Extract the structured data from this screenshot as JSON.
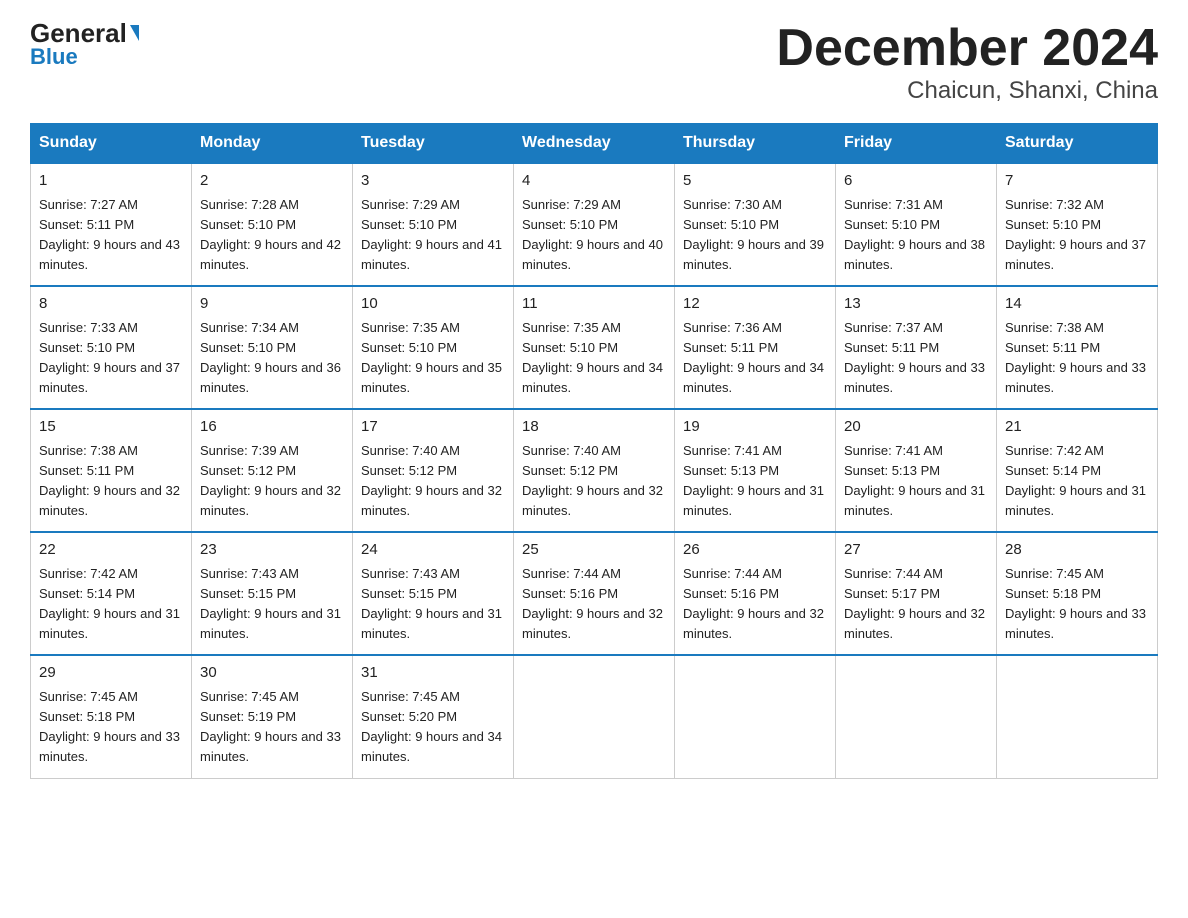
{
  "logo": {
    "general": "General",
    "blue": "Blue"
  },
  "title": "December 2024",
  "subtitle": "Chaicun, Shanxi, China",
  "weekdays": [
    "Sunday",
    "Monday",
    "Tuesday",
    "Wednesday",
    "Thursday",
    "Friday",
    "Saturday"
  ],
  "weeks": [
    [
      {
        "day": "1",
        "sunrise": "7:27 AM",
        "sunset": "5:11 PM",
        "daylight": "9 hours and 43 minutes."
      },
      {
        "day": "2",
        "sunrise": "7:28 AM",
        "sunset": "5:10 PM",
        "daylight": "9 hours and 42 minutes."
      },
      {
        "day": "3",
        "sunrise": "7:29 AM",
        "sunset": "5:10 PM",
        "daylight": "9 hours and 41 minutes."
      },
      {
        "day": "4",
        "sunrise": "7:29 AM",
        "sunset": "5:10 PM",
        "daylight": "9 hours and 40 minutes."
      },
      {
        "day": "5",
        "sunrise": "7:30 AM",
        "sunset": "5:10 PM",
        "daylight": "9 hours and 39 minutes."
      },
      {
        "day": "6",
        "sunrise": "7:31 AM",
        "sunset": "5:10 PM",
        "daylight": "9 hours and 38 minutes."
      },
      {
        "day": "7",
        "sunrise": "7:32 AM",
        "sunset": "5:10 PM",
        "daylight": "9 hours and 37 minutes."
      }
    ],
    [
      {
        "day": "8",
        "sunrise": "7:33 AM",
        "sunset": "5:10 PM",
        "daylight": "9 hours and 37 minutes."
      },
      {
        "day": "9",
        "sunrise": "7:34 AM",
        "sunset": "5:10 PM",
        "daylight": "9 hours and 36 minutes."
      },
      {
        "day": "10",
        "sunrise": "7:35 AM",
        "sunset": "5:10 PM",
        "daylight": "9 hours and 35 minutes."
      },
      {
        "day": "11",
        "sunrise": "7:35 AM",
        "sunset": "5:10 PM",
        "daylight": "9 hours and 34 minutes."
      },
      {
        "day": "12",
        "sunrise": "7:36 AM",
        "sunset": "5:11 PM",
        "daylight": "9 hours and 34 minutes."
      },
      {
        "day": "13",
        "sunrise": "7:37 AM",
        "sunset": "5:11 PM",
        "daylight": "9 hours and 33 minutes."
      },
      {
        "day": "14",
        "sunrise": "7:38 AM",
        "sunset": "5:11 PM",
        "daylight": "9 hours and 33 minutes."
      }
    ],
    [
      {
        "day": "15",
        "sunrise": "7:38 AM",
        "sunset": "5:11 PM",
        "daylight": "9 hours and 32 minutes."
      },
      {
        "day": "16",
        "sunrise": "7:39 AM",
        "sunset": "5:12 PM",
        "daylight": "9 hours and 32 minutes."
      },
      {
        "day": "17",
        "sunrise": "7:40 AM",
        "sunset": "5:12 PM",
        "daylight": "9 hours and 32 minutes."
      },
      {
        "day": "18",
        "sunrise": "7:40 AM",
        "sunset": "5:12 PM",
        "daylight": "9 hours and 32 minutes."
      },
      {
        "day": "19",
        "sunrise": "7:41 AM",
        "sunset": "5:13 PM",
        "daylight": "9 hours and 31 minutes."
      },
      {
        "day": "20",
        "sunrise": "7:41 AM",
        "sunset": "5:13 PM",
        "daylight": "9 hours and 31 minutes."
      },
      {
        "day": "21",
        "sunrise": "7:42 AM",
        "sunset": "5:14 PM",
        "daylight": "9 hours and 31 minutes."
      }
    ],
    [
      {
        "day": "22",
        "sunrise": "7:42 AM",
        "sunset": "5:14 PM",
        "daylight": "9 hours and 31 minutes."
      },
      {
        "day": "23",
        "sunrise": "7:43 AM",
        "sunset": "5:15 PM",
        "daylight": "9 hours and 31 minutes."
      },
      {
        "day": "24",
        "sunrise": "7:43 AM",
        "sunset": "5:15 PM",
        "daylight": "9 hours and 31 minutes."
      },
      {
        "day": "25",
        "sunrise": "7:44 AM",
        "sunset": "5:16 PM",
        "daylight": "9 hours and 32 minutes."
      },
      {
        "day": "26",
        "sunrise": "7:44 AM",
        "sunset": "5:16 PM",
        "daylight": "9 hours and 32 minutes."
      },
      {
        "day": "27",
        "sunrise": "7:44 AM",
        "sunset": "5:17 PM",
        "daylight": "9 hours and 32 minutes."
      },
      {
        "day": "28",
        "sunrise": "7:45 AM",
        "sunset": "5:18 PM",
        "daylight": "9 hours and 33 minutes."
      }
    ],
    [
      {
        "day": "29",
        "sunrise": "7:45 AM",
        "sunset": "5:18 PM",
        "daylight": "9 hours and 33 minutes."
      },
      {
        "day": "30",
        "sunrise": "7:45 AM",
        "sunset": "5:19 PM",
        "daylight": "9 hours and 33 minutes."
      },
      {
        "day": "31",
        "sunrise": "7:45 AM",
        "sunset": "5:20 PM",
        "daylight": "9 hours and 34 minutes."
      },
      null,
      null,
      null,
      null
    ]
  ]
}
